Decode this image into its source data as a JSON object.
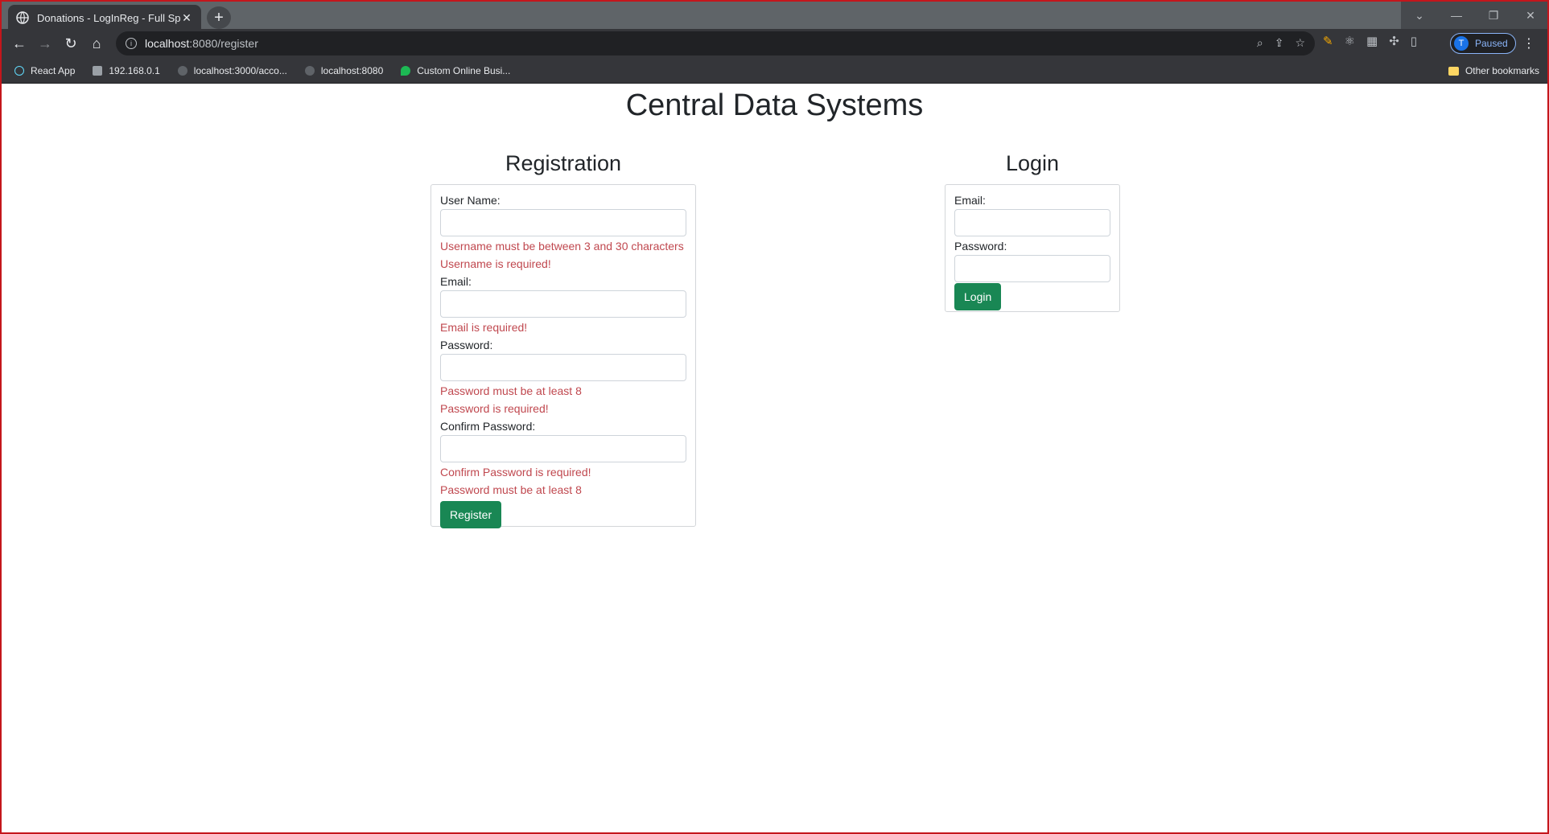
{
  "browser": {
    "tab_title": "Donations - LogInReg - Full Sprin",
    "url_host": "localhost",
    "url_rest": ":8080/register",
    "profile_initial": "T",
    "profile_status": "Paused",
    "bookmarks": [
      {
        "label": "React App",
        "color": "#61dafb"
      },
      {
        "label": "192.168.0.1",
        "color": "#9aa0a6"
      },
      {
        "label": "localhost:3000/acco...",
        "color": "#5f6368"
      },
      {
        "label": "localhost:8080",
        "color": "#5f6368"
      },
      {
        "label": "Custom Online Busi...",
        "color": "#1db954"
      }
    ],
    "other_bookmarks": "Other bookmarks"
  },
  "page": {
    "title": "Central Data Systems"
  },
  "registration": {
    "heading": "Registration",
    "username_label": "User Name:",
    "username_error_1": "Username must be between 3 and 30 characters",
    "username_error_2": "Username is required!",
    "email_label": "Email:",
    "email_error": "Email is required!",
    "password_label": "Password:",
    "password_error_1": "Password must be at least 8",
    "password_error_2": "Password is required!",
    "confirm_label": "Confirm Password:",
    "confirm_error_1": "Confirm Password is required!",
    "confirm_error_2": "Password must be at least 8",
    "submit_label": "Register"
  },
  "login": {
    "heading": "Login",
    "email_label": "Email:",
    "password_label": "Password:",
    "submit_label": "Login"
  },
  "colors": {
    "button_green": "#198754",
    "error_red": "#c0484f"
  }
}
